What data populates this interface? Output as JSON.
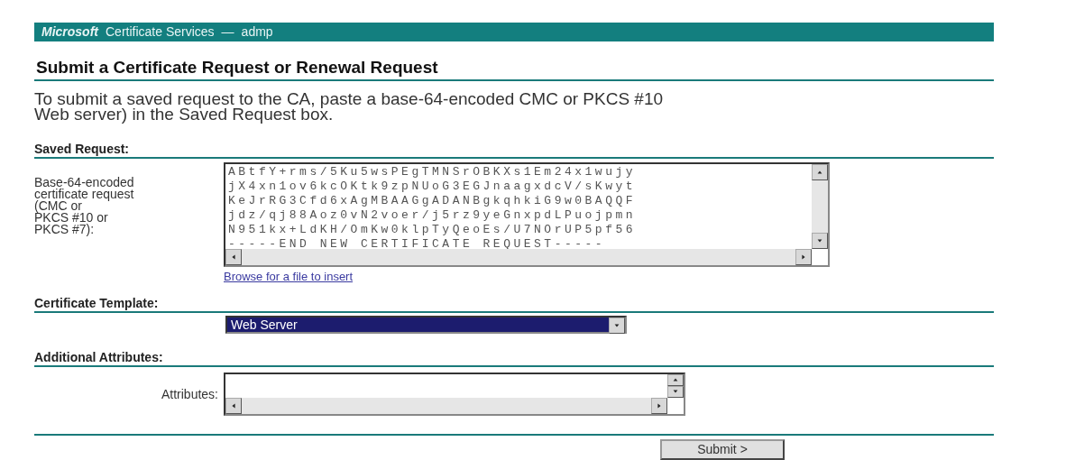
{
  "header": {
    "brand": "Microsoft",
    "title": "Certificate Services",
    "separator": "—",
    "server": "admp"
  },
  "page_title": "Submit a Certificate Request or Renewal Request",
  "intro": [
    "To submit a saved request to the CA, paste a base-64-encoded CMC or PKCS #10",
    "Web server) in the Saved Request box."
  ],
  "saved_request": {
    "heading": "Saved Request:",
    "label": [
      "Base-64-encoded",
      "certificate request",
      "(CMC or",
      "PKCS #10 or",
      "PKCS #7):"
    ],
    "lines": [
      "ABtfY+rms/5Ku5wsPEgTMNSrOBKXs1Em24x1wujy",
      "jX4xn1ov6kcOKtk9zpNUoG3EGJnaagxdcV/sKwyt",
      "KeJrRG3Cfd6xAgMBAAGgADANBgkqhkiG9w0BAQQF",
      "jdz/qj88Aoz0vN2voer/j5rz9yeGnxpdLPuojpmn",
      "N951kx+LdKH/OmKw0klpTyQeoEs/U7NOrUP5pf56",
      "-----END NEW CERTIFICATE REQUEST-----"
    ],
    "link": "Browse for a file to insert"
  },
  "certificate_template": {
    "heading": "Certificate Template:",
    "value": "Web Server",
    "focused": true
  },
  "additional_attributes": {
    "heading": "Additional Attributes:",
    "label": "Attributes:"
  },
  "submit": "Submit >"
}
